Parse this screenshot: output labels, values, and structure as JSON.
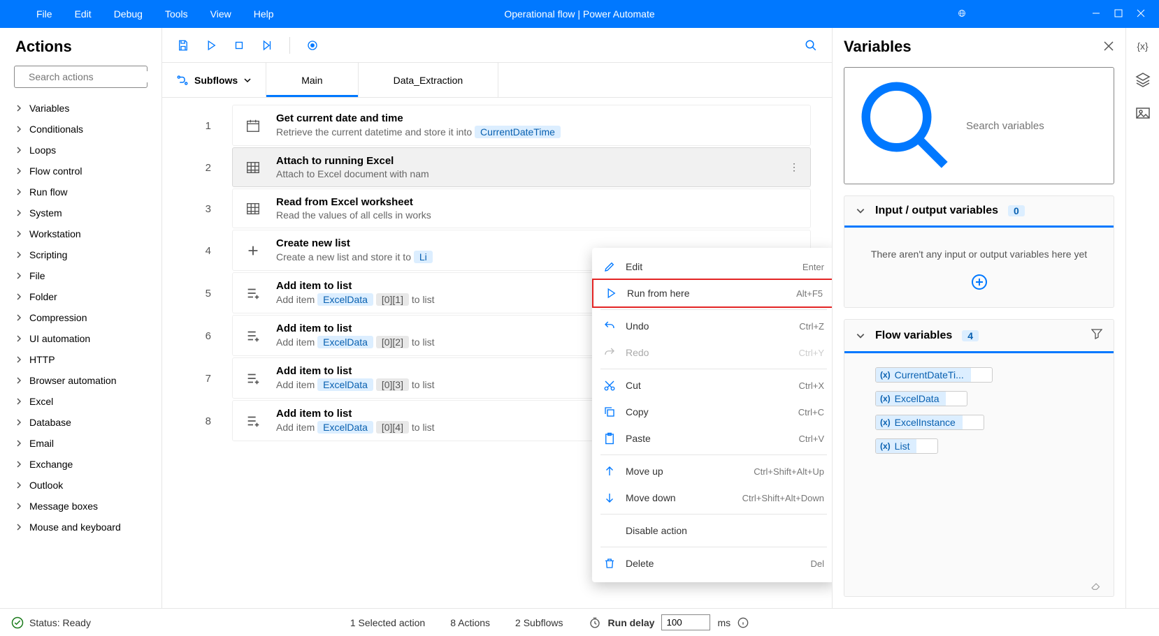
{
  "titlebar": {
    "menus": [
      "File",
      "Edit",
      "Debug",
      "Tools",
      "View",
      "Help"
    ],
    "title": "Operational flow | Power Automate"
  },
  "actions_panel": {
    "heading": "Actions",
    "search_placeholder": "Search actions",
    "categories": [
      "Variables",
      "Conditionals",
      "Loops",
      "Flow control",
      "Run flow",
      "System",
      "Workstation",
      "Scripting",
      "File",
      "Folder",
      "Compression",
      "UI automation",
      "HTTP",
      "Browser automation",
      "Excel",
      "Database",
      "Email",
      "Exchange",
      "Outlook",
      "Message boxes",
      "Mouse and keyboard"
    ]
  },
  "subflows_label": "Subflows",
  "tabs": [
    {
      "label": "Main",
      "active": true
    },
    {
      "label": "Data_Extraction",
      "active": false
    }
  ],
  "steps": [
    {
      "num": 1,
      "icon": "calendar",
      "title": "Get current date and time",
      "desc_prefix": "Retrieve the current datetime and store it into ",
      "var": "CurrentDateTime"
    },
    {
      "num": 2,
      "icon": "excel",
      "title": "Attach to running Excel",
      "desc_prefix": "Attach to Excel document with nam",
      "selected": true
    },
    {
      "num": 3,
      "icon": "excel",
      "title": "Read from Excel worksheet",
      "desc_prefix": "Read the values of all cells in works"
    },
    {
      "num": 4,
      "icon": "plus",
      "title": "Create new list",
      "desc_prefix": "Create a new list and store it to ",
      "var": "Li"
    },
    {
      "num": 5,
      "icon": "listadd",
      "title": "Add item to list",
      "desc_prefix": "Add item ",
      "var": "ExcelData",
      "idx": "[0][1]",
      "suffix": " to list"
    },
    {
      "num": 6,
      "icon": "listadd",
      "title": "Add item to list",
      "desc_prefix": "Add item ",
      "var": "ExcelData",
      "idx": "[0][2]",
      "suffix": " to list"
    },
    {
      "num": 7,
      "icon": "listadd",
      "title": "Add item to list",
      "desc_prefix": "Add item ",
      "var": "ExcelData",
      "idx": "[0][3]",
      "suffix": " to list"
    },
    {
      "num": 8,
      "icon": "listadd",
      "title": "Add item to list",
      "desc_prefix": "Add item ",
      "var": "ExcelData",
      "idx": "[0][4]",
      "suffix": " to list"
    }
  ],
  "context_menu": [
    {
      "icon": "edit",
      "label": "Edit",
      "shortcut": "Enter"
    },
    {
      "icon": "play",
      "label": "Run from here",
      "shortcut": "Alt+F5",
      "highlighted": true
    },
    {
      "sep": true
    },
    {
      "icon": "undo",
      "label": "Undo",
      "shortcut": "Ctrl+Z"
    },
    {
      "icon": "redo",
      "label": "Redo",
      "shortcut": "Ctrl+Y",
      "disabled": true
    },
    {
      "sep": true
    },
    {
      "icon": "cut",
      "label": "Cut",
      "shortcut": "Ctrl+X"
    },
    {
      "icon": "copy",
      "label": "Copy",
      "shortcut": "Ctrl+C"
    },
    {
      "icon": "paste",
      "label": "Paste",
      "shortcut": "Ctrl+V"
    },
    {
      "sep": true
    },
    {
      "icon": "up",
      "label": "Move up",
      "shortcut": "Ctrl+Shift+Alt+Up"
    },
    {
      "icon": "down",
      "label": "Move down",
      "shortcut": "Ctrl+Shift+Alt+Down"
    },
    {
      "sep": true
    },
    {
      "icon": "",
      "label": "Disable action",
      "shortcut": ""
    },
    {
      "sep": true
    },
    {
      "icon": "delete",
      "label": "Delete",
      "shortcut": "Del"
    }
  ],
  "vars_panel": {
    "heading": "Variables",
    "search_placeholder": "Search variables",
    "io_section": {
      "title": "Input / output variables",
      "count": "0",
      "empty": "There aren't any input or output variables here yet"
    },
    "flow_section": {
      "title": "Flow variables",
      "count": "4",
      "vars": [
        "CurrentDateTi...",
        "ExcelData",
        "ExcelInstance",
        "List"
      ]
    }
  },
  "statusbar": {
    "status": "Status: Ready",
    "selected": "1 Selected action",
    "actions": "8 Actions",
    "subflows": "2 Subflows",
    "run_delay_label": "Run delay",
    "run_delay_value": "100",
    "ms": "ms"
  }
}
